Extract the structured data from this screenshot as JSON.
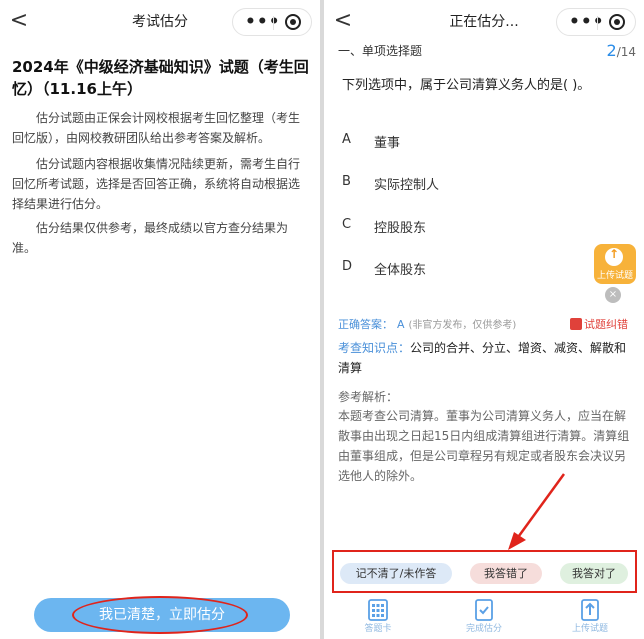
{
  "left": {
    "header": {
      "title": "考试估分"
    },
    "exam_title": "2024年《中级经济基础知识》试题（考生回忆）（11.16上午）",
    "paragraphs": [
      "估分试题由正保会计网校根据考生回忆整理（考生回忆版），由网校教研团队给出参考答案及解析。",
      "估分试题内容根据收集情况陆续更新，需考生自行回忆所考试题，选择是否回答正确，系统将自动根据选择结果进行估分。",
      "估分结果仅供参考，最终成绩以官方查分结果为准。"
    ],
    "confirm_button": "我已清楚，立即估分"
  },
  "right": {
    "header": {
      "title": "正在估分..."
    },
    "section_label": "一、单项选择题",
    "counter": {
      "current": "2",
      "total": "/14"
    },
    "question": "下列选项中，属于公司清算义务人的是(    )。",
    "options": [
      {
        "letter": "A",
        "text": "董事"
      },
      {
        "letter": "B",
        "text": "实际控制人"
      },
      {
        "letter": "C",
        "text": "控股股东"
      },
      {
        "letter": "D",
        "text": "全体股东"
      }
    ],
    "upload_float_label": "上传试题",
    "close_icon": "×",
    "answer": {
      "key": "正确答案：",
      "value": "A",
      "note": "(非官方发布，仅供参考)"
    },
    "report_label": "试题纠错",
    "knowledge": {
      "key": "考查知识点：",
      "value": "公司的合并、分立、增资、减资、解散和清算"
    },
    "analysis": {
      "heading": "参考解析：",
      "body": "本题考查公司清算。董事为公司清算义务人，应当在解散事由出现之日起15日内组成清算组进行清算。清算组由董事组成，但是公司章程另有规定或者股东会决议另选他人的除外。"
    },
    "choices": [
      "记不清了/未作答",
      "我答错了",
      "我答对了"
    ],
    "tabs": [
      {
        "label": "答题卡",
        "icon": "grid-icon"
      },
      {
        "label": "完成估分",
        "icon": "check-doc-icon"
      },
      {
        "label": "上传试题",
        "icon": "upload-icon"
      }
    ]
  },
  "colors": {
    "accent_blue": "#2b8de8",
    "button_blue": "#6cb6f0",
    "highlight_red": "#e0241b",
    "upload_orange": "#f7b23a"
  }
}
